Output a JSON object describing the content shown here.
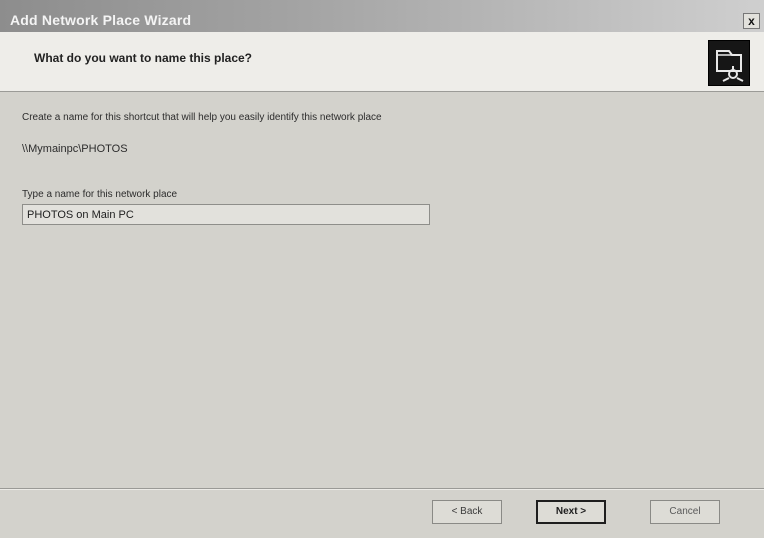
{
  "window": {
    "title": "Add Network Place Wizard",
    "close_label": "x"
  },
  "header": {
    "title": "What do you want to name this place?",
    "icon": "network-folder-icon"
  },
  "body": {
    "description": "Create a name for this shortcut that will help you easily identify this network place",
    "network_path": "\\\\Mymainpc\\PHOTOS",
    "name_label": "Type a name for this network place",
    "name_value": "PHOTOS on Main PC"
  },
  "buttons": {
    "back": "< Back",
    "next": "Next >",
    "cancel": "Cancel"
  }
}
